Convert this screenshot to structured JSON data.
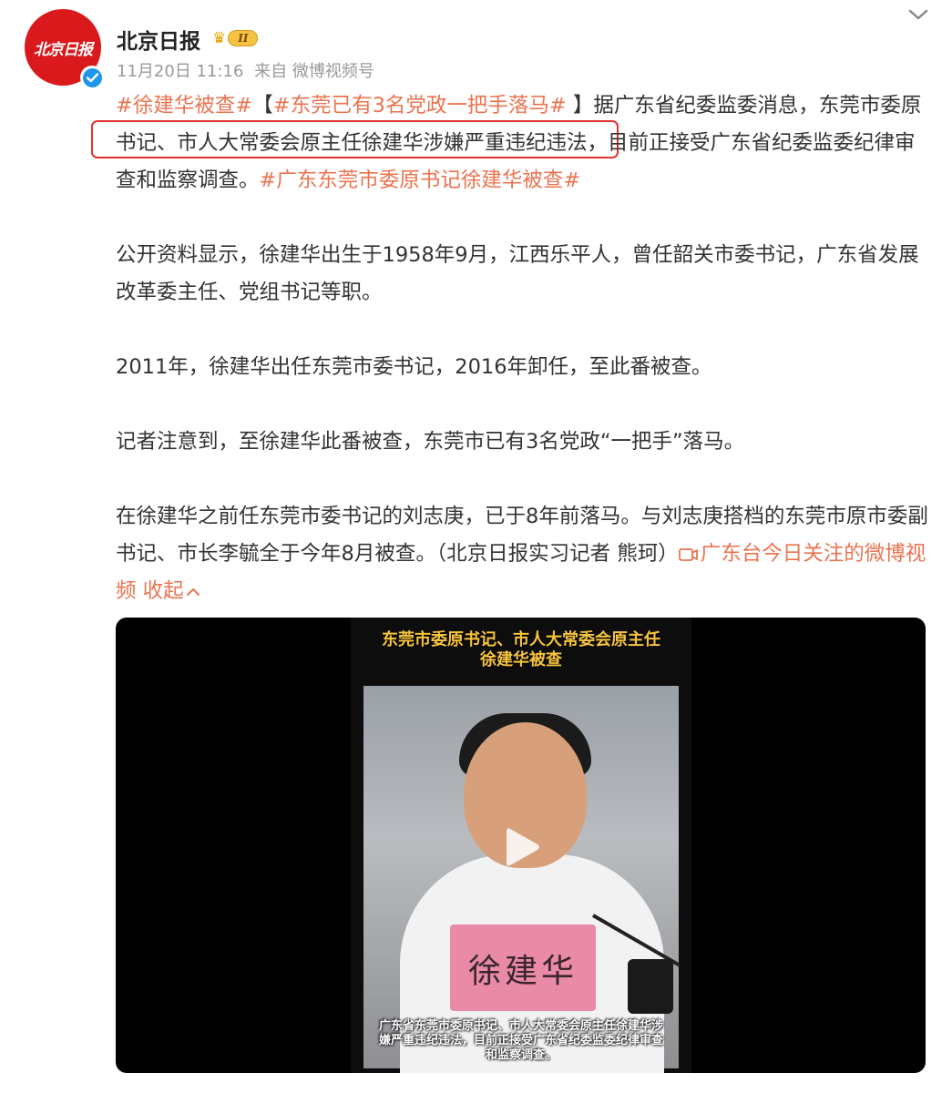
{
  "header": {
    "avatar_text": "北京日报",
    "username": "北京日报",
    "vip_level": "II",
    "date": "11月20日 11:16",
    "source": "来自 微博视频号"
  },
  "post": {
    "tag1": "#徐建华被查#",
    "bracket_open": "【",
    "tag2": "#东莞已有3名党政一把手落马#",
    "bracket_close": " 】",
    "p1_text": "据广东省纪委监委消息，东莞市委原书记、市人大常委会原主任徐建华涉嫌严重违纪违法，目前正接受广东省纪委监委纪律审查和监察调查。",
    "tag3": "#广东东莞市委原书记徐建华被查#",
    "p2": "公开资料显示，徐建华出生于1958年9月，江西乐平人，曾任韶关市委书记，广东省发展改革委主任、党组书记等职。",
    "p3": "2011年，徐建华出任东莞市委书记，2016年卸任，至此番被查。",
    "p4": "记者注意到，至徐建华此番被查，东莞市已有3名党政“一把手”落马。",
    "p5": "在徐建华之前任东莞市委书记的刘志庚，已于8年前落马。与刘志庚搭档的东莞市原市委副书记、市长李毓全于今年8月被查。（北京日报实习记者 熊珂）",
    "video_link": "广东台今日关注的微博视频",
    "collapse": "收起"
  },
  "video": {
    "title_line1": "东莞市委原书记、市人大常委会原主任",
    "title_line2": "徐建华被查",
    "nameplate": "徐建华",
    "caption": "广东省东莞市委原书记、市人大常委会原主任徐建华涉嫌严重违纪违法，目前正接受广东省纪委监委纪律审查和监察调查。"
  },
  "colors": {
    "tag": "#eb7350",
    "highlight_border": "#e3322f",
    "brand_red": "#d9191c",
    "verified_blue": "#1f96ec"
  }
}
